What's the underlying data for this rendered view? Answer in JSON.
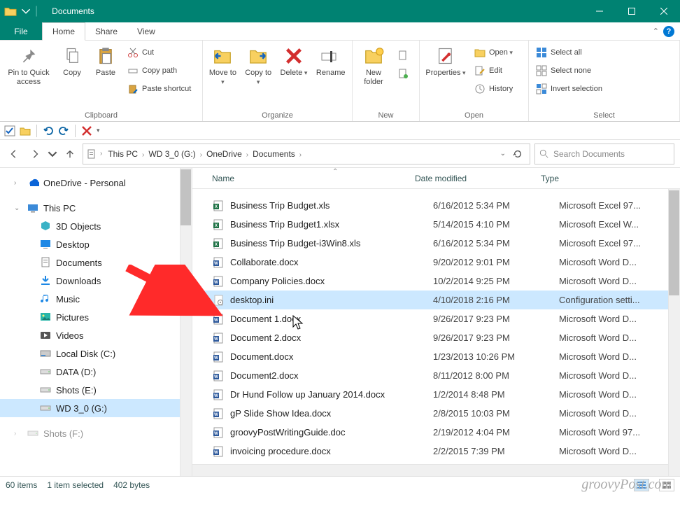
{
  "window": {
    "title": "Documents"
  },
  "tabs": {
    "file": "File",
    "home": "Home",
    "share": "Share",
    "view": "View"
  },
  "ribbon": {
    "clipboard": {
      "label": "Clipboard",
      "pin": "Pin to Quick access",
      "copy": "Copy",
      "paste": "Paste",
      "cut": "Cut",
      "copypath": "Copy path",
      "pasteshort": "Paste shortcut"
    },
    "organize": {
      "label": "Organize",
      "moveto": "Move to",
      "copyto": "Copy to",
      "delete": "Delete",
      "rename": "Rename"
    },
    "new": {
      "label": "New",
      "newfolder": "New folder"
    },
    "open": {
      "label": "Open",
      "properties": "Properties",
      "open": "Open",
      "edit": "Edit",
      "history": "History"
    },
    "select": {
      "label": "Select",
      "all": "Select all",
      "none": "Select none",
      "invert": "Invert selection"
    }
  },
  "breadcrumbs": [
    "This PC",
    "WD 3_0 (G:)",
    "OneDrive",
    "Documents"
  ],
  "search": {
    "placeholder": "Search Documents"
  },
  "tree": [
    {
      "label": "OneDrive - Personal",
      "icon": "cloud",
      "level": 1,
      "exp": ">"
    },
    {
      "spacer": true
    },
    {
      "label": "This PC",
      "icon": "pc",
      "level": 1,
      "exp": "v"
    },
    {
      "label": "3D Objects",
      "icon": "3d",
      "level": 2
    },
    {
      "label": "Desktop",
      "icon": "desktop",
      "level": 2
    },
    {
      "label": "Documents",
      "icon": "docs",
      "level": 2
    },
    {
      "label": "Downloads",
      "icon": "downloads",
      "level": 2
    },
    {
      "label": "Music",
      "icon": "music",
      "level": 2
    },
    {
      "label": "Pictures",
      "icon": "pictures",
      "level": 2
    },
    {
      "label": "Videos",
      "icon": "videos",
      "level": 2
    },
    {
      "label": "Local Disk (C:)",
      "icon": "disk",
      "level": 2
    },
    {
      "label": "DATA (D:)",
      "icon": "drive",
      "level": 2
    },
    {
      "label": "Shots (E:)",
      "icon": "drive",
      "level": 2
    },
    {
      "label": "WD 3_0 (G:)",
      "icon": "drive",
      "level": 2,
      "sel": true
    },
    {
      "spacer": true
    },
    {
      "label": "Shots (F:)",
      "icon": "drive",
      "level": 1,
      "exp": ">",
      "cut": true
    }
  ],
  "columns": {
    "name": "Name",
    "date": "Date modified",
    "type": "Type"
  },
  "files": [
    {
      "name": "Business Trip Budget.xls",
      "date": "6/16/2012 5:34 PM",
      "type": "Microsoft Excel 97...",
      "ic": "xls"
    },
    {
      "name": "Business Trip Budget1.xlsx",
      "date": "5/14/2015 4:10 PM",
      "type": "Microsoft Excel W...",
      "ic": "xlsx"
    },
    {
      "name": "Business Trip Budget-i3Win8.xls",
      "date": "6/16/2012 5:34 PM",
      "type": "Microsoft Excel 97...",
      "ic": "xls"
    },
    {
      "name": "Collaborate.docx",
      "date": "9/20/2012 9:01 PM",
      "type": "Microsoft Word D...",
      "ic": "docx"
    },
    {
      "name": "Company Policies.docx",
      "date": "10/2/2014 9:25 PM",
      "type": "Microsoft Word D...",
      "ic": "docx"
    },
    {
      "name": "desktop.ini",
      "date": "4/10/2018 2:16 PM",
      "type": "Configuration setti...",
      "ic": "ini",
      "sel": true
    },
    {
      "name": "Document 1.docx",
      "date": "9/26/2017 9:23 PM",
      "type": "Microsoft Word D...",
      "ic": "docx"
    },
    {
      "name": "Document 2.docx",
      "date": "9/26/2017 9:23 PM",
      "type": "Microsoft Word D...",
      "ic": "docx"
    },
    {
      "name": "Document.docx",
      "date": "1/23/2013 10:26 PM",
      "type": "Microsoft Word D...",
      "ic": "docx"
    },
    {
      "name": "Document2.docx",
      "date": "8/11/2012 8:00 PM",
      "type": "Microsoft Word D...",
      "ic": "docx"
    },
    {
      "name": "Dr Hund Follow up January 2014.docx",
      "date": "1/2/2014 8:48 PM",
      "type": "Microsoft Word D...",
      "ic": "docx"
    },
    {
      "name": "gP Slide Show Idea.docx",
      "date": "2/8/2015 10:03 PM",
      "type": "Microsoft Word D...",
      "ic": "docx"
    },
    {
      "name": "groovyPostWritingGuide.doc",
      "date": "2/19/2012 4:04 PM",
      "type": "Microsoft Word 97...",
      "ic": "doc"
    },
    {
      "name": "invoicing procedure.docx",
      "date": "2/2/2015 7:39 PM",
      "type": "Microsoft Word D...",
      "ic": "docx"
    }
  ],
  "status": {
    "items": "60 items",
    "selected": "1 item selected",
    "size": "402 bytes"
  },
  "watermark": "groovyPost.com"
}
